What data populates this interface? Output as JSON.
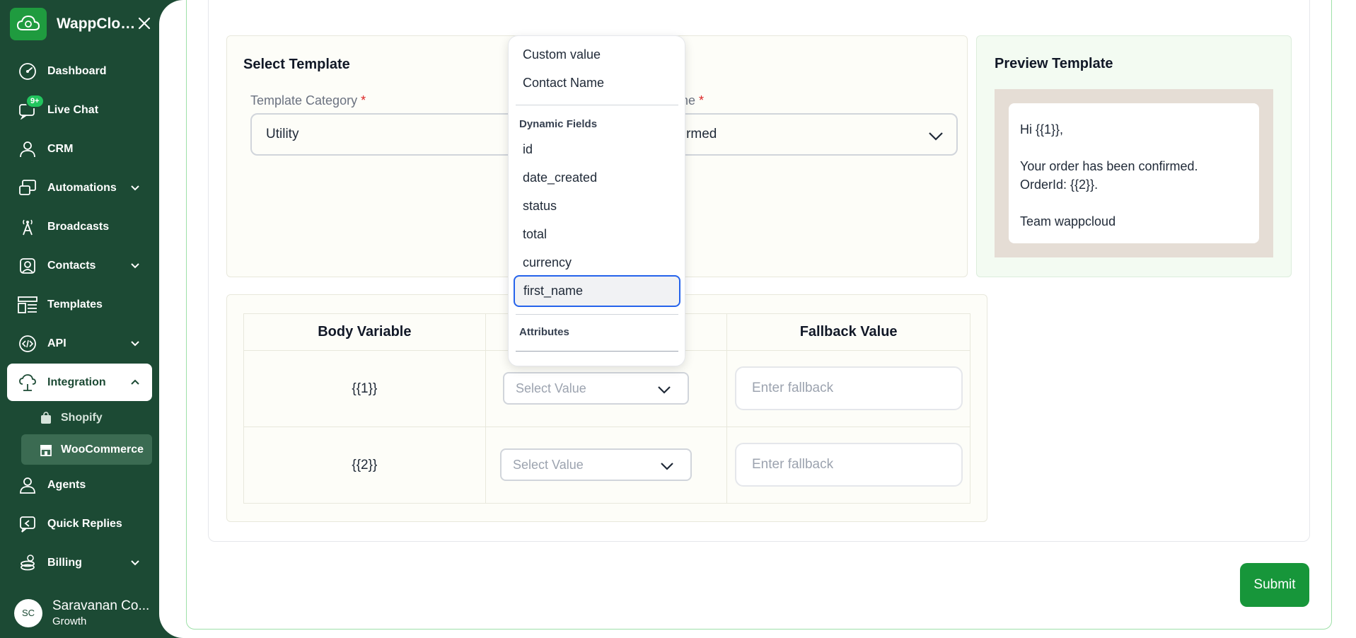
{
  "sidebar": {
    "brand": "WappCloud...",
    "items": [
      {
        "label": "Dashboard"
      },
      {
        "label": "Live Chat",
        "badge": "9+"
      },
      {
        "label": "CRM"
      },
      {
        "label": "Automations"
      },
      {
        "label": "Broadcasts"
      },
      {
        "label": "Contacts"
      },
      {
        "label": "Templates"
      },
      {
        "label": "API"
      },
      {
        "label": "Integration"
      },
      {
        "label": "Agents"
      },
      {
        "label": "Quick Replies"
      },
      {
        "label": "Billing"
      }
    ],
    "sub_items": [
      {
        "label": "Shopify"
      },
      {
        "label": "WooCommerce"
      }
    ],
    "user": {
      "initials": "SC",
      "name": "Saravanan Co...",
      "plan": "Growth"
    }
  },
  "select_template": {
    "title": "Select Template",
    "category_label": "Template Category",
    "category_value": "Utility",
    "name_label_visible": "ame",
    "name_value_visible": "nfirmed",
    "required_mark": "*"
  },
  "preview": {
    "title": "Preview Template",
    "lines": [
      "Hi {{1}},",
      "",
      "Your order has been confirmed.",
      "OrderId: {{2}}.",
      "",
      "Team wappcloud"
    ]
  },
  "variables_table": {
    "headers": [
      "Body Variable",
      "",
      "Fallback Value"
    ],
    "rows": [
      {
        "variable": "{{1}}",
        "select_placeholder": "Select Value",
        "fallback_placeholder": "Enter fallback"
      },
      {
        "variable": "{{2}}",
        "select_placeholder": "Select Value",
        "fallback_placeholder": "Enter fallback"
      }
    ]
  },
  "dropdown": {
    "top_options": [
      "Custom value",
      "Contact Name"
    ],
    "dynamic_heading": "Dynamic Fields",
    "dynamic_options": [
      "id",
      "date_created",
      "status",
      "total",
      "currency"
    ],
    "selected_option": "first_name",
    "attributes_heading": "Attributes"
  },
  "submit_label": "Submit",
  "colors": {
    "sidebar_bg": "#1c4a34",
    "accent": "#17963a",
    "focus": "#2563eb"
  }
}
